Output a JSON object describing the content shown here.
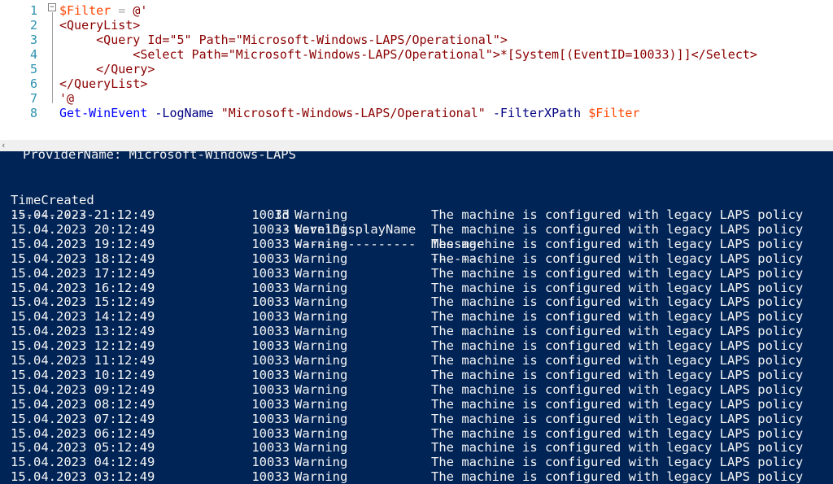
{
  "editor": {
    "lines": [
      {
        "num": "1",
        "tokens": [
          {
            "t": "$Filter",
            "c": "c-var"
          },
          {
            "t": " = ",
            "c": "c-op"
          },
          {
            "t": "@'",
            "c": "c-str"
          }
        ]
      },
      {
        "num": "2",
        "tokens": [
          {
            "t": "<QueryList>",
            "c": "c-tag"
          }
        ]
      },
      {
        "num": "3",
        "tokens": [
          {
            "t": "     <Query Id=\"5\" Path=\"Microsoft-Windows-LAPS/Operational\">",
            "c": "c-tag"
          }
        ]
      },
      {
        "num": "4",
        "tokens": [
          {
            "t": "          <Select Path=\"Microsoft-Windows-LAPS/Operational\">*[System[(EventID=10033)]]</Select>",
            "c": "c-tag"
          }
        ]
      },
      {
        "num": "5",
        "tokens": [
          {
            "t": "     </Query>",
            "c": "c-tag"
          }
        ]
      },
      {
        "num": "6",
        "tokens": [
          {
            "t": "</QueryList>",
            "c": "c-tag"
          }
        ]
      },
      {
        "num": "7",
        "tokens": [
          {
            "t": "'@",
            "c": "c-str"
          }
        ]
      },
      {
        "num": "8",
        "tokens": [
          {
            "t": "Get-WinEvent",
            "c": "c-cmd"
          },
          {
            "t": " -LogName ",
            "c": "c-param"
          },
          {
            "t": "\"Microsoft-Windows-LAPS/Operational\"",
            "c": "c-str"
          },
          {
            "t": " -FilterXPath ",
            "c": "c-param"
          },
          {
            "t": "$Filter",
            "c": "c-var"
          }
        ]
      }
    ]
  },
  "splitter": {
    "scroll_left_glyph": "‹"
  },
  "console": {
    "provider_line": "   ProviderName: Microsoft-Windows-LAPS",
    "headers": {
      "time": "TimeCreated",
      "id": "Id",
      "level": "LevelDisplayName",
      "message": "Message"
    },
    "dashes": {
      "time": "-----------",
      "id": "--",
      "level": "----------------",
      "message": "-------"
    },
    "rows": [
      {
        "time": "15.04.2023 21:12:49",
        "id": "10033",
        "level": "Warning",
        "message": "The machine is configured with legacy LAPS policy"
      },
      {
        "time": "15.04.2023 20:12:49",
        "id": "10033",
        "level": "Warning",
        "message": "The machine is configured with legacy LAPS policy"
      },
      {
        "time": "15.04.2023 19:12:49",
        "id": "10033",
        "level": "Warning",
        "message": "The machine is configured with legacy LAPS policy"
      },
      {
        "time": "15.04.2023 18:12:49",
        "id": "10033",
        "level": "Warning",
        "message": "The machine is configured with legacy LAPS policy"
      },
      {
        "time": "15.04.2023 17:12:49",
        "id": "10033",
        "level": "Warning",
        "message": "The machine is configured with legacy LAPS policy"
      },
      {
        "time": "15.04.2023 16:12:49",
        "id": "10033",
        "level": "Warning",
        "message": "The machine is configured with legacy LAPS policy"
      },
      {
        "time": "15.04.2023 15:12:49",
        "id": "10033",
        "level": "Warning",
        "message": "The machine is configured with legacy LAPS policy"
      },
      {
        "time": "15.04.2023 14:12:49",
        "id": "10033",
        "level": "Warning",
        "message": "The machine is configured with legacy LAPS policy"
      },
      {
        "time": "15.04.2023 13:12:49",
        "id": "10033",
        "level": "Warning",
        "message": "The machine is configured with legacy LAPS policy"
      },
      {
        "time": "15.04.2023 12:12:49",
        "id": "10033",
        "level": "Warning",
        "message": "The machine is configured with legacy LAPS policy"
      },
      {
        "time": "15.04.2023 11:12:49",
        "id": "10033",
        "level": "Warning",
        "message": "The machine is configured with legacy LAPS policy"
      },
      {
        "time": "15.04.2023 10:12:49",
        "id": "10033",
        "level": "Warning",
        "message": "The machine is configured with legacy LAPS policy"
      },
      {
        "time": "15.04.2023 09:12:49",
        "id": "10033",
        "level": "Warning",
        "message": "The machine is configured with legacy LAPS policy"
      },
      {
        "time": "15.04.2023 08:12:49",
        "id": "10033",
        "level": "Warning",
        "message": "The machine is configured with legacy LAPS policy"
      },
      {
        "time": "15.04.2023 07:12:49",
        "id": "10033",
        "level": "Warning",
        "message": "The machine is configured with legacy LAPS policy"
      },
      {
        "time": "15.04.2023 06:12:49",
        "id": "10033",
        "level": "Warning",
        "message": "The machine is configured with legacy LAPS policy"
      },
      {
        "time": "15.04.2023 05:12:49",
        "id": "10033",
        "level": "Warning",
        "message": "The machine is configured with legacy LAPS policy"
      },
      {
        "time": "15.04.2023 04:12:49",
        "id": "10033",
        "level": "Warning",
        "message": "The machine is configured with legacy LAPS policy"
      },
      {
        "time": "15.04.2023 03:12:49",
        "id": "10033",
        "level": "Warning",
        "message": "The machine is configured with legacy LAPS policy"
      }
    ]
  },
  "colors": {
    "console_bg": "#012456",
    "editor_bg": "#ffffff",
    "line_number": "#2b91af"
  }
}
